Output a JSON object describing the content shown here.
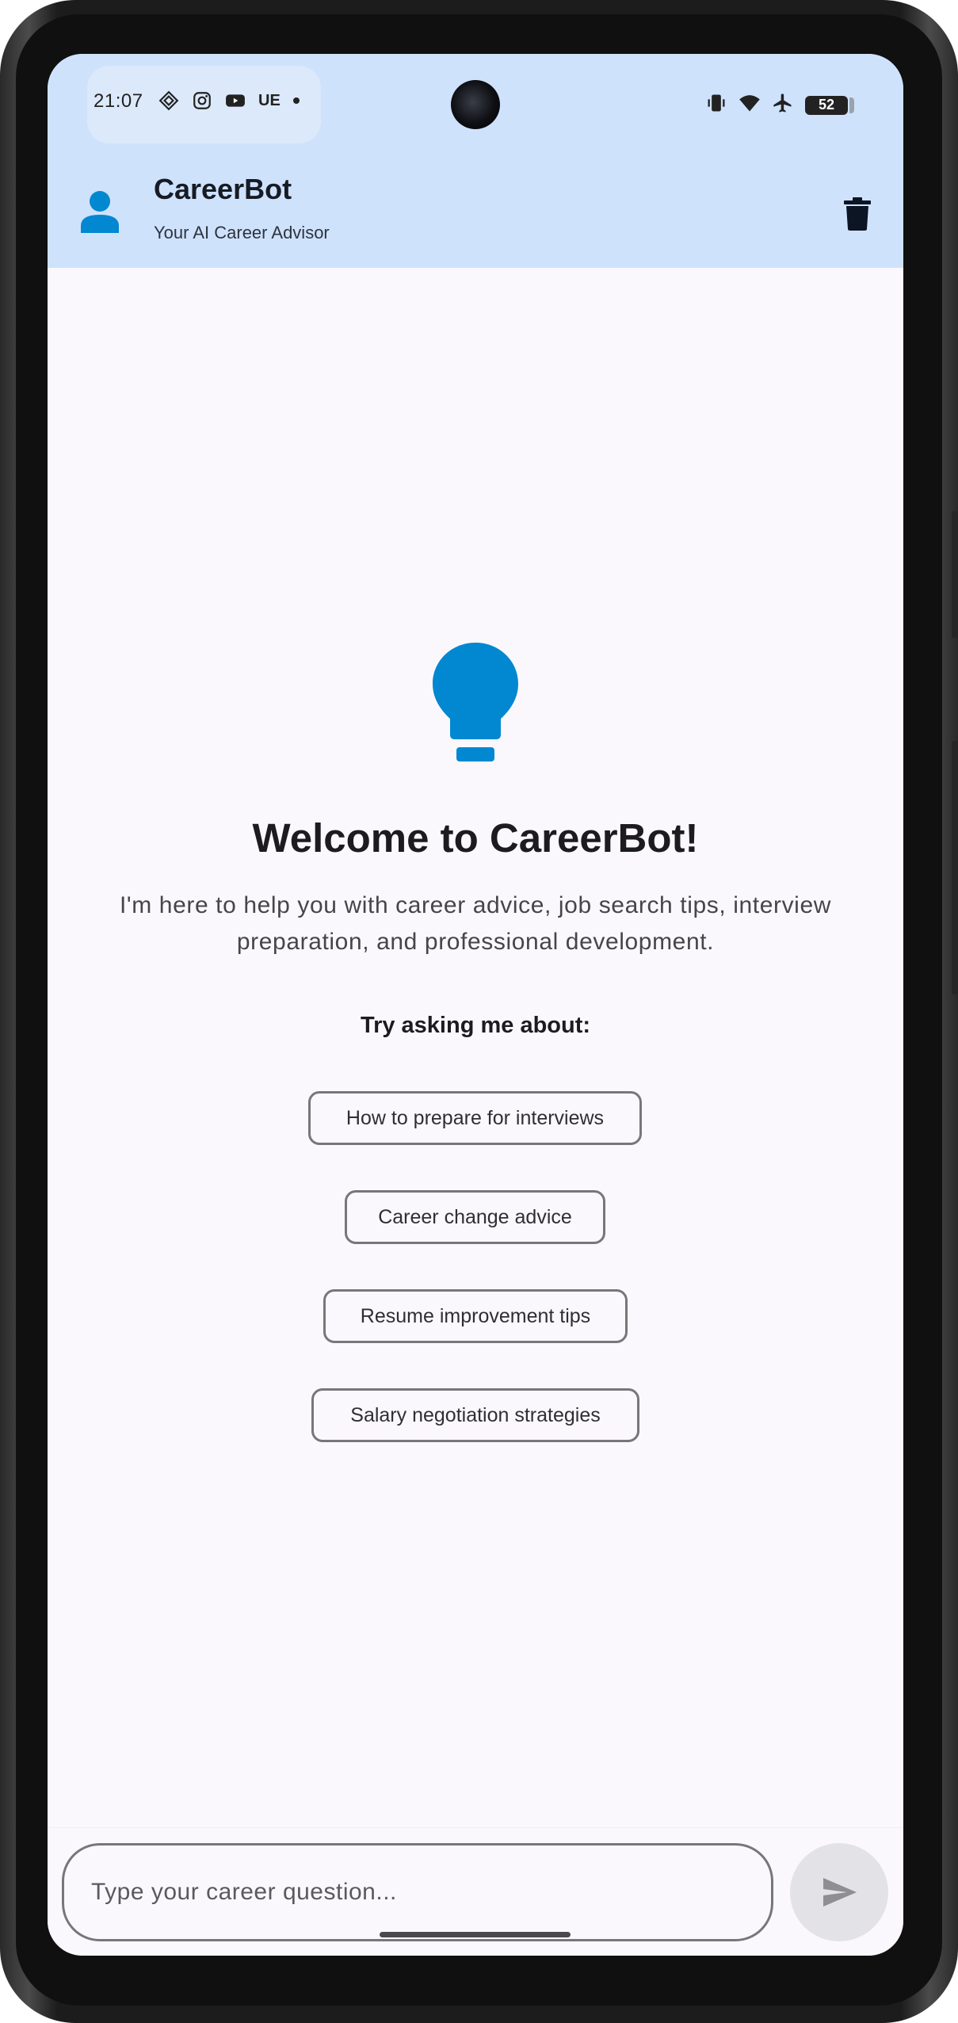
{
  "status_bar": {
    "time": "21:07",
    "carrier_badge": "UE",
    "battery_level": "52",
    "left_icons": [
      "sync-icon",
      "instagram-icon",
      "youtube-icon"
    ],
    "right_icons": [
      "vibrate-icon",
      "wifi-icon",
      "airplane-icon",
      "battery-icon"
    ]
  },
  "app_bar": {
    "title": "CareerBot",
    "subtitle": "Your AI Career Advisor",
    "leading_icon": "person-icon",
    "action_icon": "trash-icon"
  },
  "welcome": {
    "icon": "lightbulb-icon",
    "heading": "Welcome to CareerBot!",
    "intro": "I'm here to help you with career advice, job search tips, interview preparation, and professional development.",
    "try_label": "Try asking me about:",
    "suggestions": [
      "How to prepare for interviews",
      "Career change advice",
      "Resume improvement tips",
      "Salary negotiation strategies"
    ]
  },
  "composer": {
    "placeholder": "Type your career question...",
    "value": "",
    "send_icon": "send-icon"
  },
  "colors": {
    "app_bar_bg": "#cfe2fc",
    "accent": "#0288d1",
    "screen_bg": "#fbf8fd"
  }
}
